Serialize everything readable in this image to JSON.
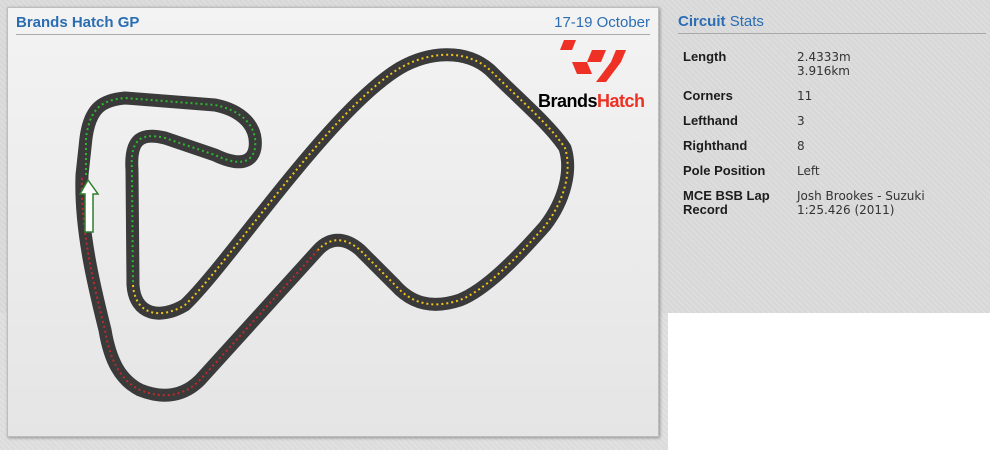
{
  "circuit_panel": {
    "title": "Brands Hatch GP",
    "date": "17-19 October",
    "logo": {
      "text_part1": "Brands",
      "text_part2": "Hatch",
      "brand_color": "#ee3124"
    },
    "sector_colors": [
      "#2fb52f",
      "#f2c418",
      "#c22a2a"
    ],
    "start_direction": "up"
  },
  "circuit_stats": {
    "title_bold": "Circuit",
    "title_rest": "Stats",
    "rows": [
      {
        "label": "Length",
        "value_line1": "2.4333m",
        "value_line2": "3.916km"
      },
      {
        "label": "Corners",
        "value_line1": "11"
      },
      {
        "label": "Lefthand",
        "value_line1": "3"
      },
      {
        "label": "Righthand",
        "value_line1": "8"
      },
      {
        "label": "Pole Position",
        "value_line1": "Left"
      },
      {
        "label_line1": "MCE BSB Lap",
        "label_line2": "Record",
        "value_line1": "Josh Brookes - Suzuki",
        "value_line2": "1:25.426 (2011)"
      }
    ]
  }
}
